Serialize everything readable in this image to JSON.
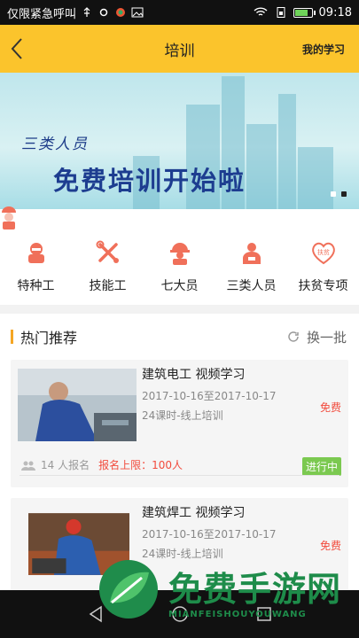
{
  "status_bar": {
    "carrier": "仅限紧急呼叫",
    "time": "09:18",
    "battery_level": 0.85
  },
  "header": {
    "title": "培训",
    "right_link": "我的学习"
  },
  "banner": {
    "line1": "三类人员",
    "line2": "免费培训开始啦",
    "page_count": 2,
    "active_page": 2
  },
  "categories": [
    {
      "label": "特种工",
      "icon": "worker-icon"
    },
    {
      "label": "技能工",
      "icon": "tools-icon"
    },
    {
      "label": "七大员",
      "icon": "hardhat-icon"
    },
    {
      "label": "三类人员",
      "icon": "id-badge-icon"
    },
    {
      "label": "扶贫专项",
      "icon": "heart-badge-icon",
      "badge_text": "扶贫"
    }
  ],
  "hot": {
    "title": "热门推荐",
    "refresh_label": "换一批"
  },
  "courses": [
    {
      "title": "建筑电工 视频学习",
      "date": "2017-10-16至2017-10-17",
      "mode": "24课时-线上培训",
      "price": "免费",
      "enrolled": "14 人报名",
      "limit": "报名上限：100人",
      "status": "进行中"
    },
    {
      "title": "建筑焊工 视频学习",
      "date": "2017-10-16至2017-10-17",
      "mode": "24课时-线上培训",
      "price": "免费"
    }
  ],
  "watermark": {
    "text": "免费手游网",
    "sub": "MIANFEISHOUYOUWANG"
  },
  "colors": {
    "accent": "#fbc42c",
    "icon_red": "#f0705a",
    "price_red": "#f24b3d",
    "status_green": "#7bc950"
  }
}
